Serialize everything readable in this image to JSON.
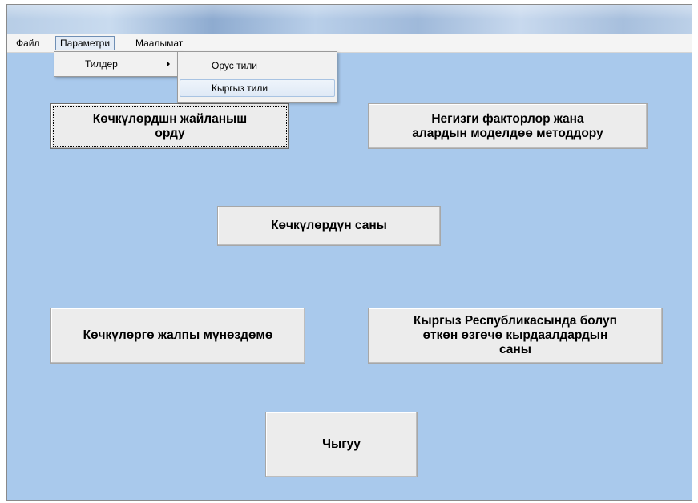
{
  "menubar": {
    "items": [
      "Файл",
      "Параметри",
      "Маалымат"
    ]
  },
  "menu": {
    "parameters": {
      "item": "Тилдер"
    },
    "languages": {
      "items": [
        "Орус тили",
        "Кыргыз тили"
      ]
    }
  },
  "buttons": {
    "placement": "Көчкүлөрдшн жайланыш\nорду",
    "factors": "Негизги факторлор жана\nалардын моделдөө методдору",
    "count": "Көчкүлөрдүн саны",
    "general": "Көчкүлөргө жалпы мүнөздөмө",
    "emergencies": "Кыргыз Республикасында болуп\nөткөн өзгөчө кырдаалдардын\nсаны",
    "exit": "Чыгуу"
  }
}
